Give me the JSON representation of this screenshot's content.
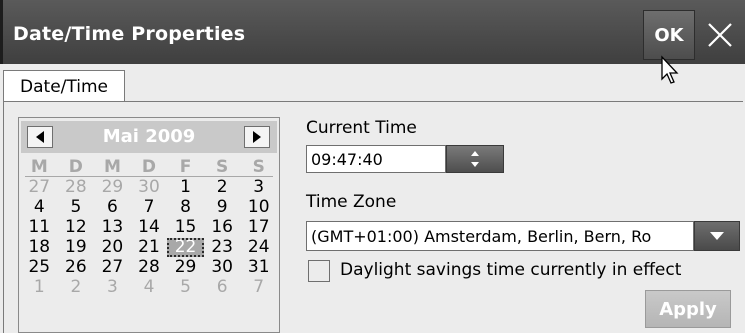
{
  "window": {
    "title": "Date/Time Properties",
    "ok_label": "OK"
  },
  "tabs": [
    {
      "label": "Date/Time",
      "active": true
    }
  ],
  "calendar": {
    "month_label": "Mai 2009",
    "weekdays": [
      "M",
      "D",
      "M",
      "D",
      "F",
      "S",
      "S"
    ],
    "weeks": [
      [
        "27",
        "28",
        "29",
        "30",
        "1",
        "2",
        "3"
      ],
      [
        "4",
        "5",
        "6",
        "7",
        "8",
        "9",
        "10"
      ],
      [
        "11",
        "12",
        "13",
        "14",
        "15",
        "16",
        "17"
      ],
      [
        "18",
        "19",
        "20",
        "21",
        "22",
        "23",
        "24"
      ],
      [
        "25",
        "26",
        "27",
        "28",
        "29",
        "30",
        "31"
      ],
      [
        "1",
        "2",
        "3",
        "4",
        "5",
        "6",
        "7"
      ]
    ],
    "selected_day": "22"
  },
  "current_time": {
    "label": "Current Time",
    "value": "09:47:40"
  },
  "time_zone": {
    "label": "Time Zone",
    "value": "(GMT+01:00) Amsterdam, Berlin, Bern, Ro"
  },
  "daylight": {
    "label": "Daylight savings time currently in effect",
    "checked": false
  },
  "apply_label": "Apply",
  "colors": {
    "titlebar": "#4a4a4a",
    "background": "#ececec",
    "disabled_text": "#a8a8a8"
  }
}
